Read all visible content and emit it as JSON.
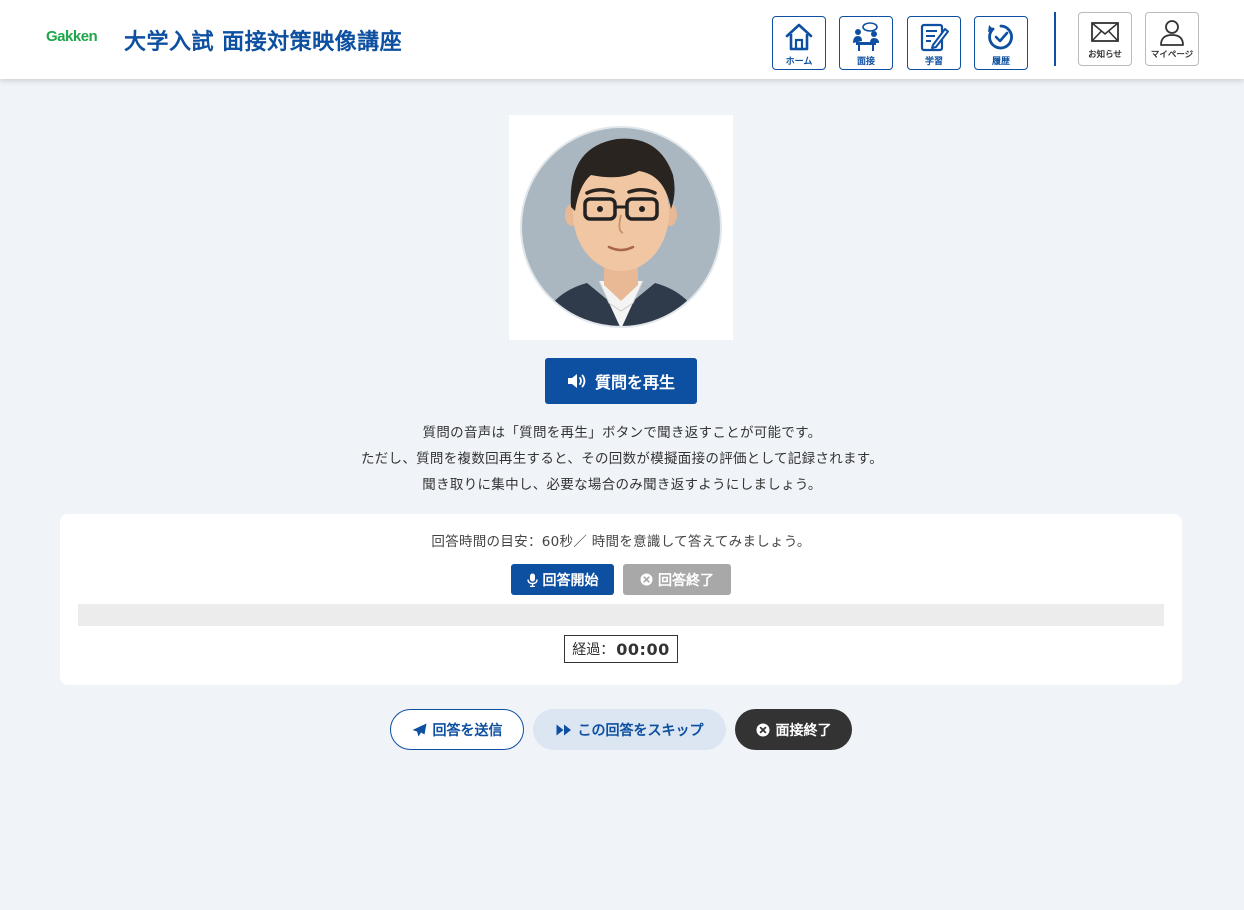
{
  "header": {
    "logo": "Gakken",
    "title": "大学入試 面接対策映像講座",
    "nav": [
      {
        "label": "ホーム",
        "icon": "home-icon"
      },
      {
        "label": "面接",
        "icon": "interview-icon"
      },
      {
        "label": "学習",
        "icon": "study-icon"
      },
      {
        "label": "履歴",
        "icon": "history-icon"
      }
    ],
    "notifications_label": "お知らせ",
    "mypage_label": "マイページ"
  },
  "question": {
    "play_label": "質問を再生",
    "notice_lines": [
      "質問の音声は「質問を再生」ボタンで聞き返すことが可能です。",
      "ただし、質問を複数回再生すると、その回数が模擬面接の評価として記録されます。",
      "聞き取りに集中し、必要な場合のみ聞き返すようにしましょう。"
    ]
  },
  "answer": {
    "hint": "回答時間の目安：60秒／ 時間を意識して答えてみましょう。",
    "start_label": "回答開始",
    "end_label": "回答終了",
    "progress": 0,
    "elapsed_label": "経過：",
    "elapsed_value": "00:00"
  },
  "actions": {
    "send_label": "回答を送信",
    "skip_label": "この回答をスキップ",
    "quit_label": "面接終了"
  },
  "colors": {
    "primary": "#0d4fa0",
    "brand_green": "#1fa64a",
    "page_bg": "#f0f4f9",
    "disabled": "#a8a8a8",
    "dark": "#333333"
  }
}
